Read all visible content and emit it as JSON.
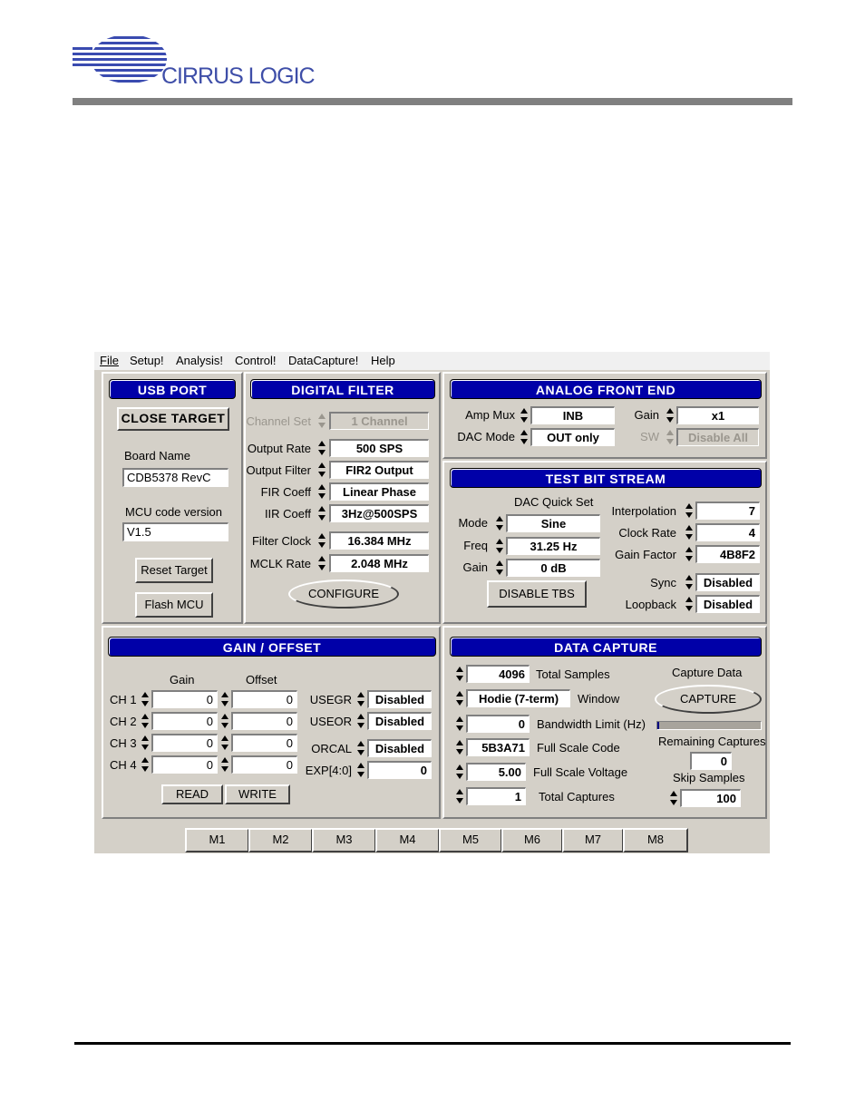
{
  "header": {
    "logo_text": "CIRRUS LOGIC"
  },
  "menu": [
    "File",
    "Setup!",
    "Analysis!",
    "Control!",
    "DataCapture!",
    "Help"
  ],
  "usb_port": {
    "title": "USB PORT",
    "close_target": "CLOSE TARGET",
    "board_name_label": "Board Name",
    "board_name_value": "CDB5378 RevC",
    "mcu_label": "MCU code version",
    "mcu_value": "V1.5",
    "reset_target": "Reset Target",
    "flash_mcu": "Flash MCU"
  },
  "digital_filter": {
    "title": "DIGITAL FILTER",
    "rows": [
      {
        "label": "Channel Set",
        "value": "1 Channel",
        "disabled": true
      },
      {
        "label": "Output Rate",
        "value": "500 SPS"
      },
      {
        "label": "Output Filter",
        "value": "FIR2 Output"
      },
      {
        "label": "FIR Coeff",
        "value": "Linear Phase"
      },
      {
        "label": "IIR Coeff",
        "value": "3Hz@500SPS"
      },
      {
        "label": "Filter Clock",
        "value": "16.384 MHz"
      },
      {
        "label": "MCLK Rate",
        "value": "2.048 MHz"
      }
    ],
    "configure": "CONFIGURE"
  },
  "analog_front_end": {
    "title": "ANALOG FRONT END",
    "amp_mux_label": "Amp Mux",
    "amp_mux_value": "INB",
    "dac_mode_label": "DAC Mode",
    "dac_mode_value": "OUT only",
    "gain_label": "Gain",
    "gain_value": "x1",
    "sw_label": "SW",
    "sw_value": "Disable All"
  },
  "test_bit_stream": {
    "title": "TEST BIT STREAM",
    "dac_quick_set": "DAC Quick Set",
    "mode_label": "Mode",
    "mode_value": "Sine",
    "freq_label": "Freq",
    "freq_value": "31.25 Hz",
    "gain_label": "Gain",
    "gain_value": "0 dB",
    "disable_tbs": "DISABLE TBS",
    "interpolation_label": "Interpolation",
    "interpolation_value": "7",
    "clock_rate_label": "Clock Rate",
    "clock_rate_value": "4",
    "gain_factor_label": "Gain Factor",
    "gain_factor_value": "4B8F2",
    "sync_label": "Sync",
    "sync_value": "Disabled",
    "loopback_label": "Loopback",
    "loopback_value": "Disabled"
  },
  "gain_offset": {
    "title": "GAIN / OFFSET",
    "gain_header": "Gain",
    "offset_header": "Offset",
    "channels": [
      {
        "label": "CH 1",
        "gain": "0",
        "offset": "0"
      },
      {
        "label": "CH 2",
        "gain": "0",
        "offset": "0"
      },
      {
        "label": "CH 3",
        "gain": "0",
        "offset": "0"
      },
      {
        "label": "CH 4",
        "gain": "0",
        "offset": "0"
      }
    ],
    "usegr_label": "USEGR",
    "usegr_value": "Disabled",
    "useor_label": "USEOR",
    "useor_value": "Disabled",
    "orcal_label": "ORCAL",
    "orcal_value": "Disabled",
    "exp_label": "EXP[4:0]",
    "exp_value": "0",
    "read": "READ",
    "write": "WRITE"
  },
  "data_capture": {
    "title": "DATA CAPTURE",
    "total_samples_value": "4096",
    "total_samples_label": "Total Samples",
    "window_value": "Hodie (7-term)",
    "window_label": "Window",
    "bandwidth_value": "0",
    "bandwidth_label": "Bandwidth Limit (Hz)",
    "full_scale_code_value": "5B3A71",
    "full_scale_code_label": "Full Scale Code",
    "full_scale_voltage_value": "5.00",
    "full_scale_voltage_label": "Full Scale Voltage",
    "total_captures_value": "1",
    "total_captures_label": "Total Captures",
    "capture_data_label": "Capture Data",
    "capture_button": "CAPTURE",
    "progress_fraction": 0.02,
    "remaining_captures_label": "Remaining Captures",
    "remaining_captures_value": "0",
    "skip_samples_label": "Skip Samples",
    "skip_samples_value": "100"
  },
  "tabs": [
    "M1",
    "M2",
    "M3",
    "M4",
    "M5",
    "M6",
    "M7",
    "M8"
  ]
}
